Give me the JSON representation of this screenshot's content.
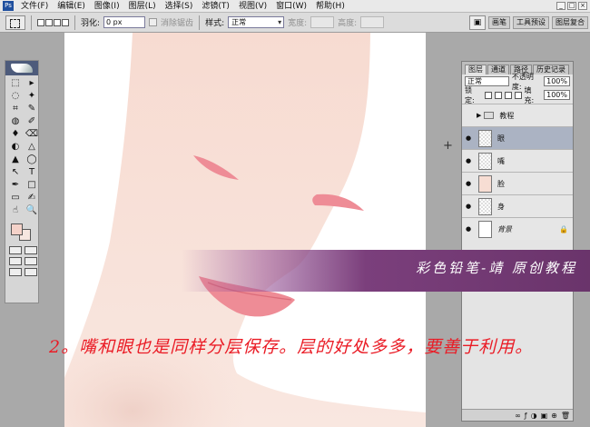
{
  "colors": {
    "skin": "#f7ddd3",
    "lip": "#ee8c96",
    "banner": "#7b3f7c",
    "caption": "#ea1b25"
  },
  "menu": {
    "logo": "Ps",
    "items": [
      "文件(F)",
      "编辑(E)",
      "图像(I)",
      "图层(L)",
      "选择(S)",
      "滤镜(T)",
      "视图(V)",
      "窗口(W)",
      "帮助(H)"
    ],
    "window_controls": [
      "_",
      "□",
      "×"
    ]
  },
  "options": {
    "feather_label": "羽化:",
    "feather_value": "0 px",
    "antialias_label": "消除锯齿",
    "style_label": "样式:",
    "style_value": "正常",
    "width_label": "宽度:",
    "height_label": "高度:",
    "docs": [
      "画笔",
      "工具预设",
      "图层复合"
    ]
  },
  "toolbox": {
    "icons": [
      "⬚",
      "▸",
      "◌",
      "✦",
      "⌗",
      "✎",
      "◍",
      "✐",
      "♦",
      "⌫",
      "◐",
      "△",
      "▲",
      "◯",
      "↖",
      "T",
      "✒",
      "□",
      "▭",
      "✍",
      "☝",
      "🔍"
    ]
  },
  "layers_panel": {
    "tabs": [
      "图层",
      "通道",
      "路径",
      "历史记录"
    ],
    "blend_mode": "正常",
    "opacity_label": "不透明度:",
    "opacity_value": "100%",
    "lock_label": "锁定:",
    "fill_label": "填充:",
    "fill_value": "100%",
    "group_name": "教程",
    "layers": [
      {
        "name": "眼",
        "selected": true,
        "thumb": "check"
      },
      {
        "name": "嘴",
        "selected": false,
        "thumb": "check"
      },
      {
        "name": "脸",
        "selected": false,
        "thumb": "face"
      },
      {
        "name": "身",
        "selected": false,
        "thumb": "check"
      },
      {
        "name": "背景",
        "selected": false,
        "thumb": "white"
      }
    ],
    "bottom_icons": [
      "∞",
      "ƒ",
      "◑",
      "▣",
      "⊕",
      "🗑"
    ]
  },
  "banner_text": "彩色铅笔-靖 原创教程",
  "caption_text": "2。嘴和眼也是同样分层保存。层的好处多多，要善于利用。"
}
